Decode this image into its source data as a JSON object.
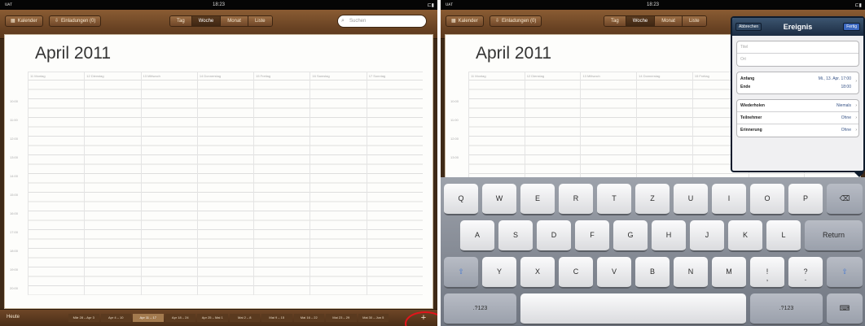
{
  "status": {
    "carrier": "ᴜᴀᴛ",
    "time": "18:23",
    "battery": "⊏▮"
  },
  "toolbar": {
    "calendars_label": "Kalender",
    "invites_label": "Einladungen (0)",
    "view_tabs": [
      "Tag",
      "Woche",
      "Monat",
      "Liste"
    ],
    "active_tab": "Woche",
    "search_placeholder": "Suchen"
  },
  "calendar": {
    "month_title": "April 2011",
    "days": [
      "11 Montag",
      "12 Dienstag",
      "13 Mittwoch",
      "14 Donnerstag",
      "15 Freitag",
      "16 Samstag",
      "17 Sonntag"
    ],
    "hours": [
      "",
      "10:00",
      "11:00",
      "12:00",
      "13:00",
      "14:00",
      "15:00",
      "16:00",
      "17:00",
      "18:00",
      "19:00",
      "20:00",
      "21:00"
    ]
  },
  "bottombar": {
    "today_label": "Heute",
    "weeks": [
      "Mär 28 – Apr 3",
      "Apr 4 – 10",
      "Apr 11 – 17",
      "Apr 18 – 24",
      "Apr 25 – Mai 1",
      "Mai 2 – 8",
      "Mai 9 – 15",
      "Mai 16 – 22",
      "Mai 23 – 29",
      "Mai 30 – Jun 5"
    ],
    "selected_week": "Apr 11 – 17",
    "add_label": "+"
  },
  "popover": {
    "cancel_label": "Abbrechen",
    "title": "Ereignis",
    "done_label": "Fertig",
    "title_placeholder": "Titel",
    "location_placeholder": "Ort",
    "start_label": "Anfang",
    "end_label": "Ende",
    "start_value": "Mi., 13. Apr. 17:00",
    "end_value": "18:00",
    "repeat_label": "Wiederholen",
    "repeat_value": "Niemals",
    "attendees_label": "Teilnehmer",
    "attendees_value": "Ohne",
    "alert_label": "Erinnerung",
    "alert_value": "Ohne"
  },
  "keyboard": {
    "row1": [
      "Q",
      "W",
      "E",
      "R",
      "T",
      "Z",
      "U",
      "I",
      "O",
      "P",
      "⌫"
    ],
    "row2": [
      "A",
      "S",
      "D",
      "F",
      "G",
      "H",
      "J",
      "K",
      "L",
      "Return"
    ],
    "row3": [
      "⇧",
      "Y",
      "X",
      "C",
      "V",
      "B",
      "N",
      "M",
      "!",
      "?",
      "⇧"
    ],
    "row3_sub": [
      "",
      "",
      "",
      "",
      "",
      "",
      "",
      "",
      ",",
      ".",
      ""
    ],
    "row4": [
      ".?123",
      "",
      ".?123",
      "⌨"
    ]
  }
}
